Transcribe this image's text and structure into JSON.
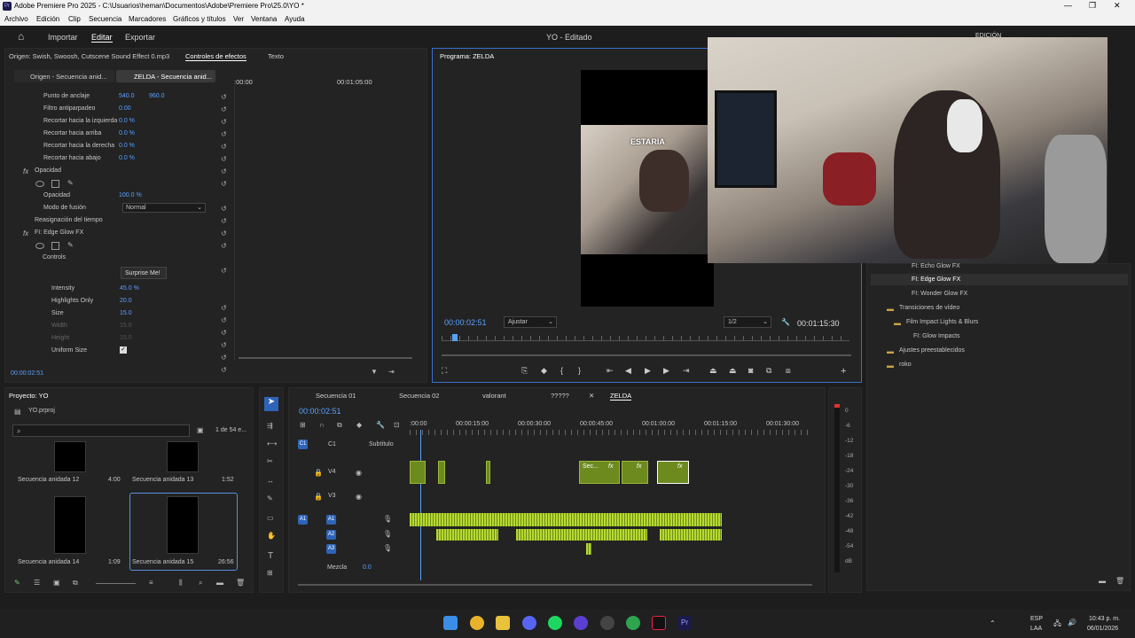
{
  "window": {
    "title": "Adobe Premiere Pro 2025 - C:\\Usuarios\\heman\\Documentos\\Adobe\\Premiere Pro\\25.0\\YO *"
  },
  "menu": [
    "Archivo",
    "Edición",
    "Clip",
    "Secuencia",
    "Marcadores",
    "Gráficos y títulos",
    "Ver",
    "Ventana",
    "Ayuda"
  ],
  "workspace": {
    "import": "Importar",
    "edit": "Editar",
    "export": "Exportar",
    "project_title": "YO - Editado",
    "mode": "EDICIÓN"
  },
  "source_panel": {
    "origin": "Origen: Swish, Swoosh, Cutscene Sound Effect 0.mp3",
    "effects_tab": "Controles de efectos",
    "text_tab": "Texto",
    "clip_tab1": "Origen - Secuencia anid...",
    "clip_tab2": "ZELDA - Secuencia anid...",
    "ruler_t1": ":00:00",
    "ruler_t2": "00:01:05:00"
  },
  "effects": {
    "anchor_label": "Punto de anclaje",
    "anchor_x": "540.0",
    "anchor_y": "960.0",
    "antiflicker_label": "Filtro antiparpadeo",
    "antiflicker": "0.00",
    "crop_left_label": "Recortar hacia la izquierda",
    "crop_left": "0.0 %",
    "crop_top_label": "Recortar hacia arriba",
    "crop_top": "0.0 %",
    "crop_right_label": "Recortar hacia la derecha",
    "crop_right": "0.0 %",
    "crop_bottom_label": "Recortar hacia abajo",
    "crop_bottom": "0.0 %",
    "opacity_section": "Opacidad",
    "opacity_label": "Opacidad",
    "opacity": "100.0 %",
    "blend_label": "Modo de fusión",
    "blend": "Normal",
    "time_remap": "Reasignación del tiempo",
    "edge_glow": "FI: Edge Glow FX",
    "controls": "Controls",
    "surprise": "Surprise Me!",
    "intensity_label": "Intensity",
    "intensity": "45.0 %",
    "highlights_label": "Highlights Only",
    "highlights": "20.0",
    "size_label": "Size",
    "size": "15.0",
    "width_label": "Width",
    "width": "15.0",
    "height_label": "Height",
    "height": "15.0",
    "uniform_label": "Uniform Size",
    "timecode": "00:00:02:51"
  },
  "program": {
    "title": "Programa: ZELDA",
    "caption": "ESTARIA",
    "timecode": "00:00:02:51",
    "fit": "Ajustar",
    "quality": "1/2",
    "duration": "00:01:15:30"
  },
  "effects_panel": {
    "items": [
      "FI: Echo Glow FX",
      "FI: Edge Glow FX",
      "FI: Wonder Glow FX"
    ],
    "transitions": "Transiciones de vídeo",
    "film_impact": "Film Impact Lights & Blurs",
    "glow_impacts": "FI: Glow Impacts",
    "presets": "Ajustes preestablecidos",
    "roko": "roko"
  },
  "project": {
    "title": "Proyecto: YO",
    "file": "YO.prproj",
    "count": "1 de 54 e...",
    "items": [
      {
        "name": "Secuencia anidada 12",
        "dur": "4:00"
      },
      {
        "name": "Secuencia anidada 13",
        "dur": "1:52"
      },
      {
        "name": "Secuencia anidada 14",
        "dur": "1:09"
      },
      {
        "name": "Secuencia anidada 15",
        "dur": "26:56"
      }
    ]
  },
  "timeline": {
    "tabs": [
      "Secuencia 01",
      "Secuencia 02",
      "valorant",
      "?????",
      "ZELDA"
    ],
    "timecode": "00:00:02:51",
    "ruler": [
      ":00:00",
      "00:00:15:00",
      "00:00:30:00",
      "00:00:45:00",
      "00:01:00:00",
      "00:01:15:00",
      "00:01:30:00"
    ],
    "subtitle": "Subtítulo",
    "c1": "C1",
    "v4": "V4",
    "v3": "V3",
    "a1": "A1",
    "a2": "A2",
    "a3": "A3",
    "mix": "Mezcla",
    "mix_val": "0.0",
    "clip_sec": "Sec...",
    "fx": "fx"
  },
  "meter": {
    "scale": [
      "0",
      "-6",
      "-12",
      "-18",
      "-24",
      "-30",
      "-36",
      "-42",
      "-48",
      "-54",
      "dB"
    ]
  },
  "taskbar": {
    "lang1": "ESP",
    "lang2": "LAA",
    "time": "10:43 p. m.",
    "date": "06/01/2026"
  }
}
